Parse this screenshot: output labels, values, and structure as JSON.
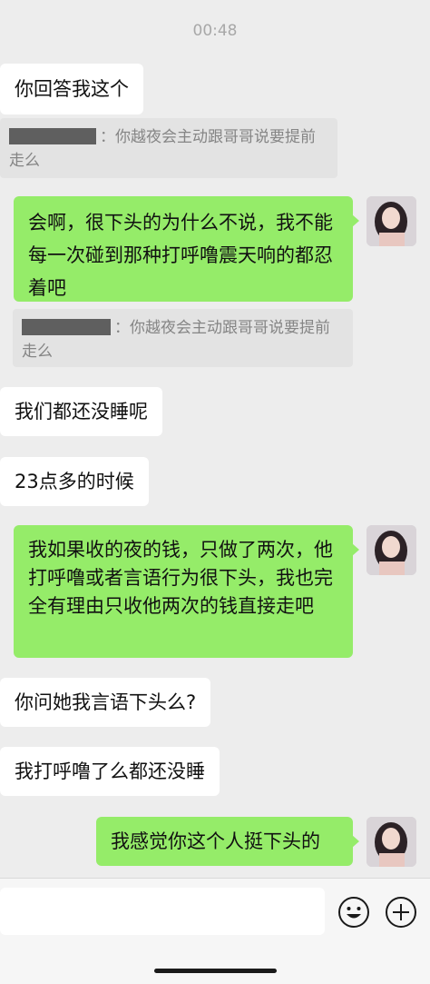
{
  "status_time": "00:48",
  "messages": [
    {
      "dir": "in",
      "text": "你回答我这个"
    },
    {
      "dir": "quote",
      "text": "：你越夜会主动跟哥哥说要提前走么"
    },
    {
      "dir": "out",
      "text": "会啊，很下头的为什么不说，我不能每一次碰到那种打呼噜震天响的都忍着吧"
    },
    {
      "dir": "quote",
      "text": "：你越夜会主动跟哥哥说要提前走么"
    },
    {
      "dir": "in",
      "text": "我们都还没睡呢"
    },
    {
      "dir": "in",
      "text": "23点多的时候"
    },
    {
      "dir": "out",
      "text": "我如果收的夜的钱，只做了两次，他打呼噜或者言语行为很下头，我也完全有理由只收他两次的钱直接走吧"
    },
    {
      "dir": "in",
      "text": "你问她我言语下头么?"
    },
    {
      "dir": "in",
      "text": "我打呼噜了么都还没睡"
    },
    {
      "dir": "out",
      "text": "我感觉你这个人挺下头的"
    }
  ],
  "input_bar": {
    "emoji_icon": "emoji-icon",
    "plus_icon": "plus-icon"
  },
  "colors": {
    "outgoing_bubble": "#95ec69",
    "incoming_bubble": "#ffffff",
    "background": "#ededed"
  }
}
